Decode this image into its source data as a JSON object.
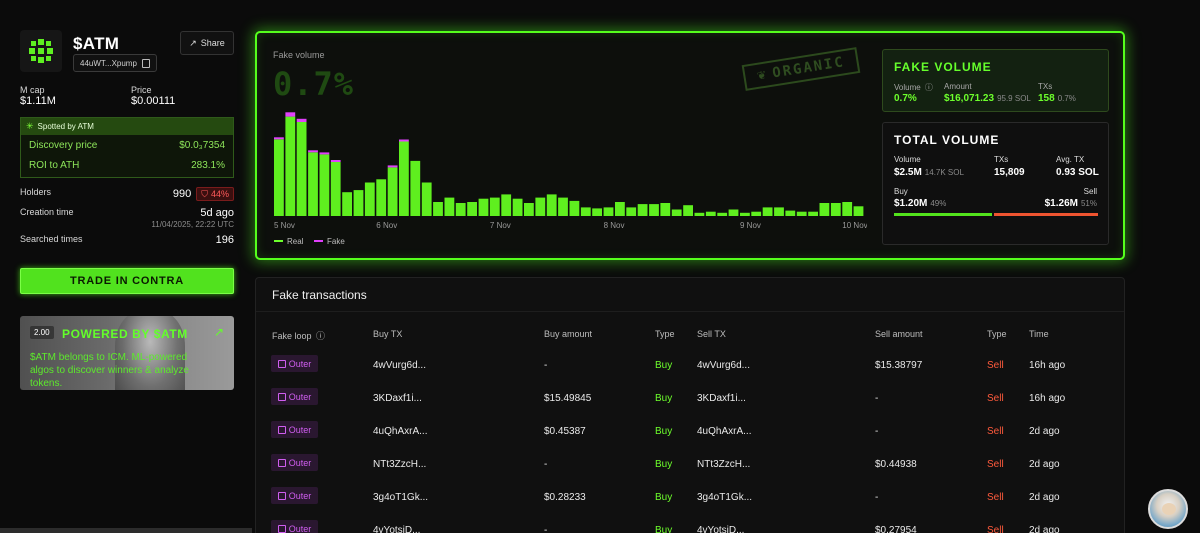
{
  "token": {
    "ticker": "$ATM",
    "address_short": "44uWT...Xpump",
    "share_label": "Share",
    "mcap_label": "M cap",
    "mcap_value": "$1.11M",
    "price_label": "Price",
    "price_value": "$0.00111"
  },
  "spotted": {
    "header": "Spotted by ATM",
    "discovery_label": "Discovery price",
    "discovery_value": "$0.0₃7354",
    "roi_label": "ROI to ATH",
    "roi_value": "283.1%"
  },
  "stats": {
    "holders_label": "Holders",
    "holders_value": "990",
    "holders_badge": "44%",
    "creation_label": "Creation time",
    "creation_value": "5d ago",
    "creation_date": "11/04/2025, 22:22 UTC",
    "searched_label": "Searched times",
    "searched_value": "196"
  },
  "trade_button": "TRADE IN CONTRA",
  "promo": {
    "zoom": "2.00",
    "title": "POWERED BY $ATM",
    "desc": "$ATM belongs to ICM. ML-powered algos to discover winners & analyze tokens.",
    "arrow_icon": "external-arrow-icon"
  },
  "chart_data": {
    "type": "bar",
    "title": "Fake volume",
    "headline_value": "0.7%",
    "stamp": "ORGANIC",
    "x_tick_labels": [
      "5 Nov",
      "6 Nov",
      "7 Nov",
      "8 Nov",
      "9 Nov",
      "10 Nov"
    ],
    "legend": [
      {
        "name": "Real",
        "color": "#6dff2c"
      },
      {
        "name": "Fake",
        "color": "#e040fb"
      }
    ],
    "ylim": [
      0,
      100
    ],
    "series": [
      {
        "name": "Real",
        "values": [
          71,
          92,
          87,
          59,
          57,
          50,
          22,
          24,
          31,
          34,
          45,
          69,
          51,
          31,
          13,
          17,
          12,
          13,
          16,
          17,
          20,
          16,
          12,
          17,
          20,
          17,
          14,
          8,
          7,
          8,
          13,
          8,
          11,
          11,
          12,
          6,
          10,
          3,
          4,
          3,
          6,
          3,
          4,
          8,
          8,
          5,
          4,
          4,
          12,
          12,
          13,
          9
        ]
      },
      {
        "name": "Fake",
        "values": [
          1.5,
          4,
          3,
          1.5,
          1.5,
          1.5,
          0,
          0,
          0,
          0,
          1,
          1,
          0,
          0,
          0,
          0,
          0,
          0,
          0,
          0,
          0,
          0,
          0,
          0,
          0,
          0,
          0,
          0,
          0,
          0,
          0,
          0,
          0,
          0,
          0,
          0,
          0,
          0,
          0,
          0,
          0,
          0,
          0,
          0,
          0,
          0,
          0,
          0,
          0,
          0,
          0,
          0
        ]
      }
    ]
  },
  "fake_volume": {
    "title": "FAKE VOLUME",
    "volume_label": "Volume",
    "volume_value": "0.7%",
    "amount_label": "Amount",
    "amount_value": "$16,071.23",
    "amount_sub": "95.9 SOL",
    "txs_label": "TXs",
    "txs_value": "158",
    "txs_sub": "0.7%"
  },
  "total_volume": {
    "title": "TOTAL VOLUME",
    "volume_label": "Volume",
    "volume_value": "$2.5M",
    "volume_sub": "14.7K SOL",
    "txs_label": "TXs",
    "txs_value": "15,809",
    "avg_label": "Avg. TX",
    "avg_value": "0.93 SOL",
    "buy_label": "Buy",
    "buy_value": "$1.20M",
    "buy_pct": "49%",
    "sell_label": "Sell",
    "sell_value": "$1.26M",
    "sell_pct": "51%",
    "buy_share": 0.49,
    "sell_share": 0.51
  },
  "transactions": {
    "title": "Fake transactions",
    "headers": [
      "Fake loop",
      "Buy TX",
      "Buy amount",
      "Type",
      "Sell TX",
      "Sell amount",
      "Type",
      "Time"
    ],
    "rows": [
      {
        "loop": "Outer",
        "buy_tx": "4wVurg6d...",
        "buy_amount": "-",
        "buy_type": "Buy",
        "sell_tx": "4wVurg6d...",
        "sell_amount": "$15.38797",
        "sell_type": "Sell",
        "time": "16h ago"
      },
      {
        "loop": "Outer",
        "buy_tx": "3KDaxf1i...",
        "buy_amount": "$15.49845",
        "buy_type": "Buy",
        "sell_tx": "3KDaxf1i...",
        "sell_amount": "-",
        "sell_type": "Sell",
        "time": "16h ago"
      },
      {
        "loop": "Outer",
        "buy_tx": "4uQhAxrA...",
        "buy_amount": "$0.45387",
        "buy_type": "Buy",
        "sell_tx": "4uQhAxrA...",
        "sell_amount": "-",
        "sell_type": "Sell",
        "time": "2d ago"
      },
      {
        "loop": "Outer",
        "buy_tx": "NTt3ZzcH...",
        "buy_amount": "-",
        "buy_type": "Buy",
        "sell_tx": "NTt3ZzcH...",
        "sell_amount": "$0.44938",
        "sell_type": "Sell",
        "time": "2d ago"
      },
      {
        "loop": "Outer",
        "buy_tx": "3g4oT1Gk...",
        "buy_amount": "$0.28233",
        "buy_type": "Buy",
        "sell_tx": "3g4oT1Gk...",
        "sell_amount": "-",
        "sell_type": "Sell",
        "time": "2d ago"
      },
      {
        "loop": "Outer",
        "buy_tx": "4vYotsiD...",
        "buy_amount": "-",
        "buy_type": "Buy",
        "sell_tx": "4vYotsiD...",
        "sell_amount": "$0.27954",
        "sell_type": "Sell",
        "time": "2d ago"
      }
    ]
  }
}
